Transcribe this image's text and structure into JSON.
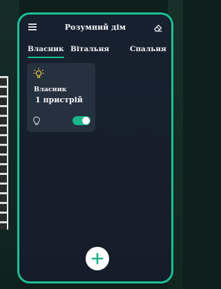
{
  "header": {
    "title": "Розумний дім",
    "menu_icon": "hamburger-menu-icon",
    "action_icon": "eraser-icon"
  },
  "tabs": [
    {
      "label": "Власник",
      "active": true
    },
    {
      "label": "Вітальня",
      "active": false
    },
    {
      "label": "Спальня",
      "active": false
    }
  ],
  "cards": [
    {
      "name": "Власник",
      "count": "1 пристрій",
      "top_icon": "bulb-on-icon",
      "bottom_icon": "bulb-icon",
      "toggle_on": true
    }
  ],
  "fab": {
    "icon": "plus-icon"
  },
  "colors": {
    "accent": "#19c28f",
    "frame": "#1dbf95",
    "screen_bg": "#161f2c",
    "card_bg": "#26313f",
    "text": "#f4f6fa"
  }
}
